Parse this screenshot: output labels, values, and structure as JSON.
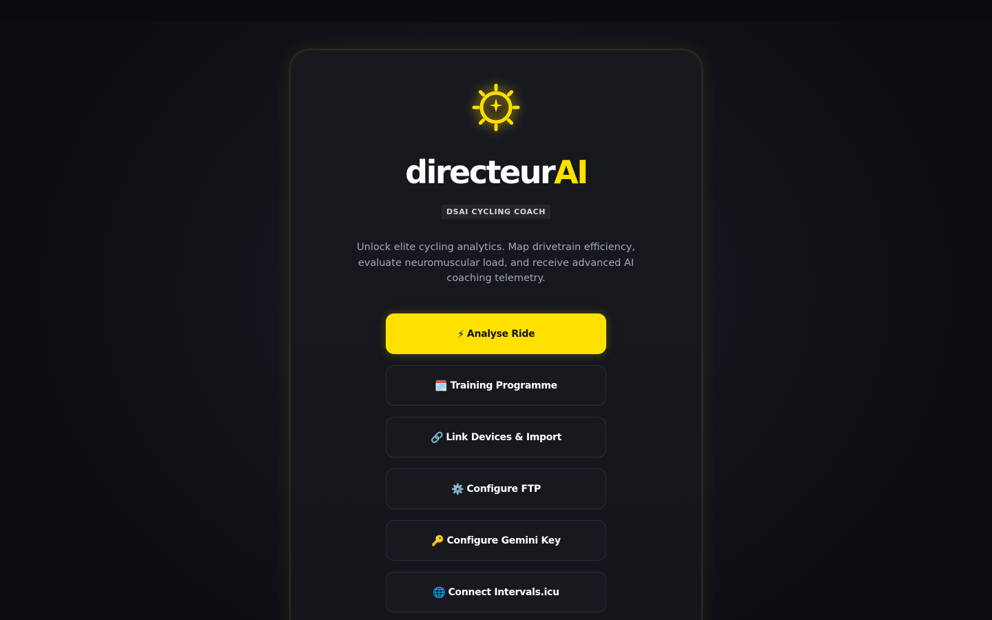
{
  "brand": {
    "name_part1": "directeur",
    "name_part2": "AI",
    "badge": "DSAI CYCLING COACH",
    "description": "Unlock elite cycling analytics. Map drivetrain efficiency, evaluate neuromuscular load, and receive advanced AI coaching telemetry.",
    "logo_icon": "sun-gear-sparkle-icon",
    "accent_color": "#ffe100"
  },
  "actions": {
    "analyse_label": "Analyse Ride",
    "analyse_icon": "⚡",
    "training_label": "Training Programme",
    "training_icon": "🗓️",
    "link_label": "Link Devices & Import",
    "link_icon": "🔗",
    "ftp_label": "Configure FTP",
    "ftp_icon": "⚙️",
    "gemini_label": "Configure Gemini Key",
    "gemini_icon": "🔑",
    "intervals_label": "Connect Intervals.icu",
    "intervals_icon": "🌐"
  }
}
